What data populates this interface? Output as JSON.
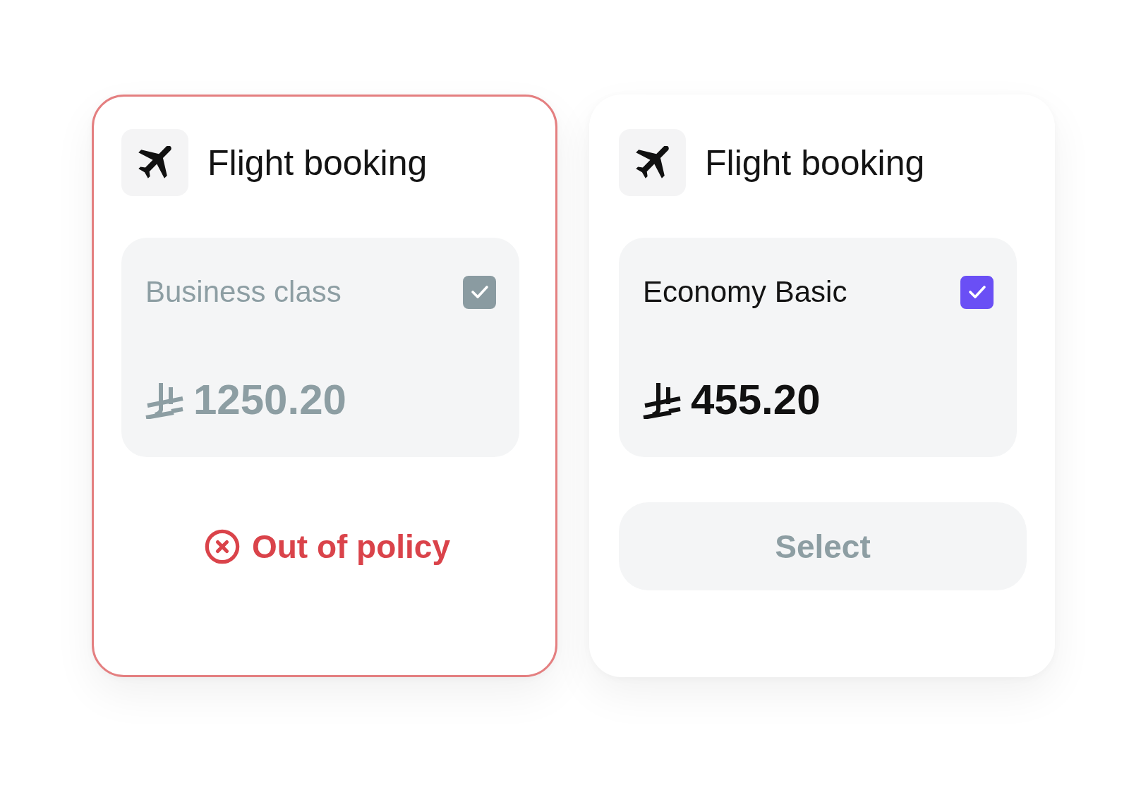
{
  "cards": [
    {
      "title": "Flight booking",
      "flagged": true,
      "fare": {
        "name": "Business class",
        "checked": true,
        "disabled": true,
        "price": "1250.20"
      },
      "footer": {
        "kind": "warning",
        "label": "Out of policy"
      }
    },
    {
      "title": "Flight booking",
      "flagged": false,
      "fare": {
        "name": "Economy Basic",
        "checked": true,
        "disabled": false,
        "price": "455.20"
      },
      "footer": {
        "kind": "button",
        "label": "Select",
        "disabled": true
      }
    }
  ]
}
